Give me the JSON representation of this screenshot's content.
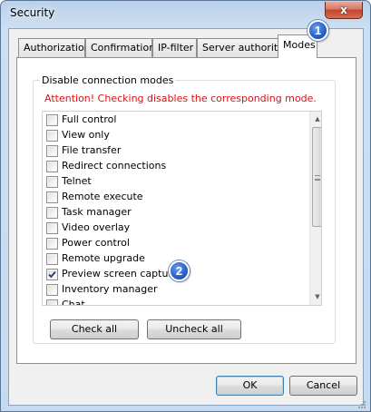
{
  "window": {
    "title": "Security",
    "close_symbol": "x"
  },
  "tabs": [
    {
      "label": "Authorization"
    },
    {
      "label": "Confirmation"
    },
    {
      "label": "IP-filter"
    },
    {
      "label": "Server authority"
    },
    {
      "label": "Modes",
      "selected": true
    }
  ],
  "group": {
    "label": "Disable connection modes",
    "attention": "Attention! Checking disables the corresponding mode."
  },
  "modes": [
    {
      "label": "Full control",
      "checked": false
    },
    {
      "label": "View only",
      "checked": false
    },
    {
      "label": "File transfer",
      "checked": false
    },
    {
      "label": "Redirect connections",
      "checked": false
    },
    {
      "label": "Telnet",
      "checked": false
    },
    {
      "label": "Remote execute",
      "checked": false
    },
    {
      "label": "Task manager",
      "checked": false
    },
    {
      "label": "Video overlay",
      "checked": false
    },
    {
      "label": "Power control",
      "checked": false
    },
    {
      "label": "Remote upgrade",
      "checked": false
    },
    {
      "label": "Preview screen capture",
      "checked": true
    },
    {
      "label": "Inventory manager",
      "checked": false
    },
    {
      "label": "Chat",
      "checked": false
    }
  ],
  "buttons": {
    "check_all": "Check all",
    "uncheck_all": "Uncheck all",
    "ok": "OK",
    "cancel": "Cancel"
  },
  "badges": {
    "tab_marker": "1",
    "item_marker": "2"
  },
  "colors": {
    "attention": "#e01010",
    "badge": "#2b62c8",
    "title_bar": "#b9d1ea"
  }
}
